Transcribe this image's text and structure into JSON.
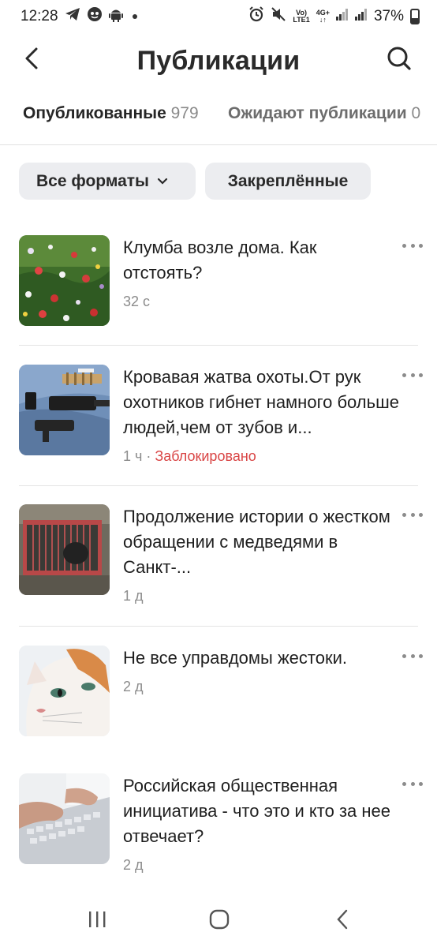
{
  "status_bar": {
    "time": "12:28",
    "net_top": "Vo)",
    "net_bottom": "LTE1",
    "net2_top": "4G+",
    "net2_bottom": "↓↑",
    "battery": "37%",
    "battery_level": 0.37
  },
  "header": {
    "title": "Публикации"
  },
  "tabs": [
    {
      "label": "Опубликованные",
      "count": "979"
    },
    {
      "label": "Ожидают публикации",
      "count": "0"
    }
  ],
  "filters": {
    "formats_label": "Все форматы",
    "pinned_label": "Закреплённые"
  },
  "posts": [
    {
      "title": "Клумба возле дома. Как отстоять?",
      "time": "32 с",
      "status": ""
    },
    {
      "title": "Кровавая жатва охоты.От рук охотников гибнет намного больше людей,чем от зубов и...",
      "time": "1 ч",
      "status": "Заблокировано"
    },
    {
      "title": "Продолжение истории о жестком обращении с медведями в Санкт-...",
      "time": "1 д",
      "status": ""
    },
    {
      "title": "Не все управдомы жестоки.",
      "time": "2 д",
      "status": ""
    },
    {
      "title": "Российская общественная инициатива - что это и кто за нее отвечает?",
      "time": "2 д",
      "status": ""
    }
  ],
  "colors": {
    "blocked": "#d94545",
    "chip_bg": "#ecedf0"
  }
}
